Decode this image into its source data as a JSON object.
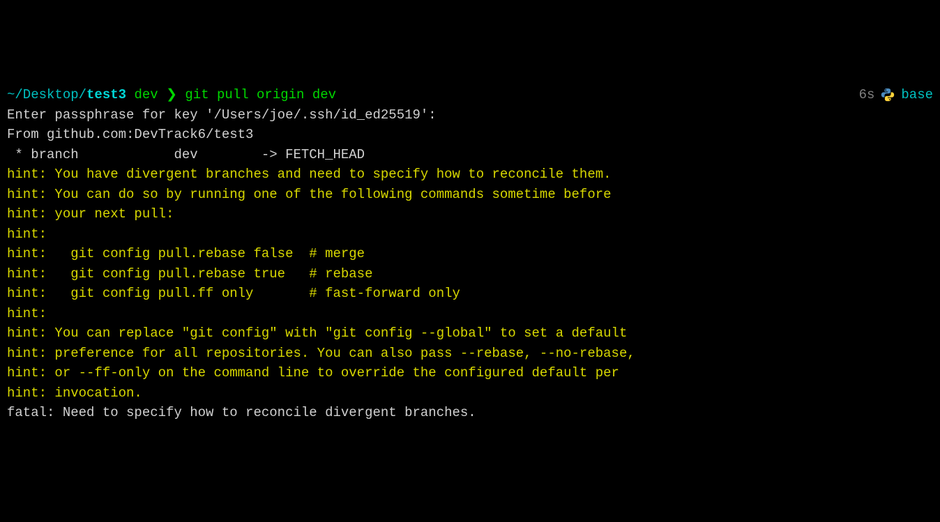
{
  "prompt": {
    "path_prefix": "~/Desktop/",
    "dir": "test3",
    "branch": "dev",
    "separator": "❯",
    "command": "git pull origin dev",
    "elapsed": "6s",
    "env": "base"
  },
  "output": {
    "line1": "Enter passphrase for key '/Users/joe/.ssh/id_ed25519':",
    "line2": "From github.com:DevTrack6/test3",
    "line3": " * branch            dev        -> FETCH_HEAD",
    "hints": [
      "hint: You have divergent branches and need to specify how to reconcile them.",
      "hint: You can do so by running one of the following commands sometime before",
      "hint: your next pull:",
      "hint:",
      "hint:   git config pull.rebase false  # merge",
      "hint:   git config pull.rebase true   # rebase",
      "hint:   git config pull.ff only       # fast-forward only",
      "hint:",
      "hint: You can replace \"git config\" with \"git config --global\" to set a default",
      "hint: preference for all repositories. You can also pass --rebase, --no-rebase,",
      "hint: or --ff-only on the command line to override the configured default per",
      "hint: invocation."
    ],
    "fatal": "fatal: Need to specify how to reconcile divergent branches."
  }
}
